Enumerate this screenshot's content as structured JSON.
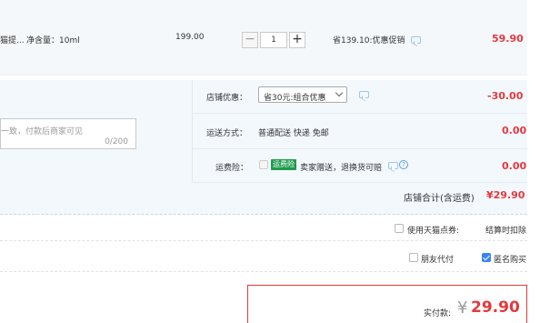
{
  "item": {
    "desc": "猫提...",
    "spec": "净含量：10ml",
    "unit_price": "199.00",
    "quantity": "1",
    "qty_minus": "−",
    "qty_plus": "+",
    "promo": "省139.10:优惠促销",
    "subtotal": "59.90"
  },
  "shop": {
    "discount_label": "店铺优惠：",
    "discount_value": "省30元:组合优惠",
    "discount_amount": "-30.00",
    "message_placeholder": "一致，付款后商家可见",
    "message_count": "0/200",
    "shipping_label": "运送方式：",
    "shipping_value": "普通配送 快递 免邮",
    "shipping_amount": "0.00",
    "insurance_label": "运费险：",
    "insurance_badge": "运费险",
    "insurance_text": "卖家赠送，退换货可赔",
    "insurance_amount": "0.00",
    "total_label": "店铺合计(含运费)",
    "total_value": "¥29.90"
  },
  "options": {
    "tmall_coupon_label": "使用天猫点券:",
    "tmall_coupon_note": "结算时扣除",
    "friend_pay_label": "朋友代付",
    "anonymous_label": "匿名购买"
  },
  "payment": {
    "label": "实付款:",
    "currency": "¥",
    "amount": "29.90"
  },
  "colors": {
    "accent_red": "#e4393c",
    "badge_green": "#1e9b4c",
    "checkbox_blue": "#3b83f4"
  }
}
